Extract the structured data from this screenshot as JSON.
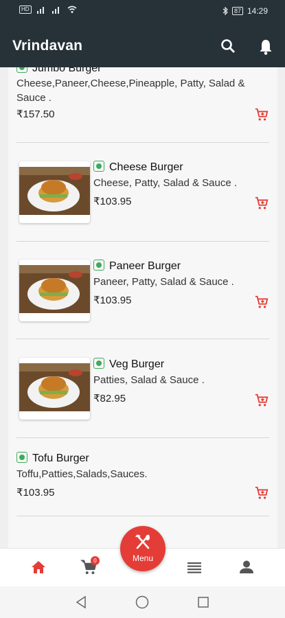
{
  "status_bar": {
    "time": "14:29",
    "battery": "87"
  },
  "app_bar": {
    "title": "Vrindavan",
    "search_icon": "search-icon",
    "bell_icon": "bell-icon"
  },
  "menu_items": [
    {
      "name": "Jumbo Burger",
      "description_line1": "Cheese,Paneer,Cheese,Pineapple, Patty, Salad &",
      "description_line2": "Sauce .",
      "price": "₹157.50"
    },
    {
      "name": "Cheese Burger",
      "description": "Cheese, Patty, Salad & Sauce .",
      "price": "₹103.95"
    },
    {
      "name": "Paneer Burger",
      "description": "Paneer, Patty, Salad & Sauce .",
      "price": "₹103.95"
    },
    {
      "name": "Veg Burger",
      "description": "Patties, Salad & Sauce .",
      "price": "₹82.95"
    },
    {
      "name": "Tofu Burger",
      "description": "Toffu,Patties,Salads,Sauces.",
      "price": "₹103.95"
    }
  ],
  "bottom_nav": {
    "cart_count": "0",
    "menu_label": "Menu"
  },
  "colors": {
    "accent": "#e43d37",
    "appbar": "#263238",
    "veg": "#3cab5a"
  }
}
